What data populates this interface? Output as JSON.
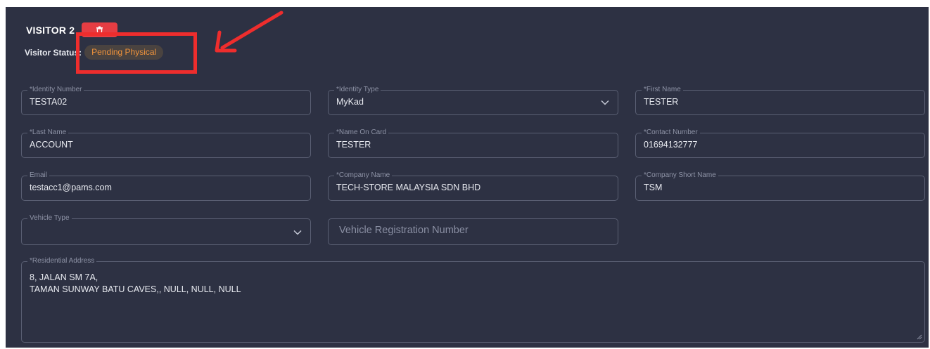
{
  "visitor": {
    "title": "VISITOR 2",
    "status_label": "Visitor Status:",
    "status_value": "Pending Physical"
  },
  "fields": {
    "identity_number": {
      "label": "*Identity Number",
      "value": "TESTA02"
    },
    "identity_type": {
      "label": "*Identity Type",
      "value": "MyKad"
    },
    "first_name": {
      "label": "*First Name",
      "value": "TESTER"
    },
    "last_name": {
      "label": "*Last Name",
      "value": "ACCOUNT"
    },
    "name_on_card": {
      "label": "*Name On Card",
      "value": "TESTER"
    },
    "contact_number": {
      "label": "*Contact Number",
      "value": "01694132777"
    },
    "email": {
      "label": "Email",
      "value": "testacc1@pams.com"
    },
    "company_name": {
      "label": "*Company Name",
      "value": "TECH-STORE MALAYSIA SDN BHD"
    },
    "company_short_name": {
      "label": "*Company Short Name",
      "value": "TSM"
    },
    "vehicle_type": {
      "label": "Vehicle Type",
      "value": ""
    },
    "vehicle_registration": {
      "placeholder": "Vehicle Registration Number"
    },
    "residential_address": {
      "label": "*Residential Address",
      "value": "8, JALAN SM 7A,\nTAMAN SUNWAY BATU CAVES,, NULL, NULL, NULL"
    }
  },
  "icons": {
    "delete": "trash-icon",
    "dropdown": "chevron-down-icon",
    "annotation": "red-arrow"
  },
  "colors": {
    "panel_bg": "#2d3143",
    "delete_button": "#e53d43",
    "status_badge_text": "#f0933c",
    "annotation_red": "#ee2d2d"
  }
}
